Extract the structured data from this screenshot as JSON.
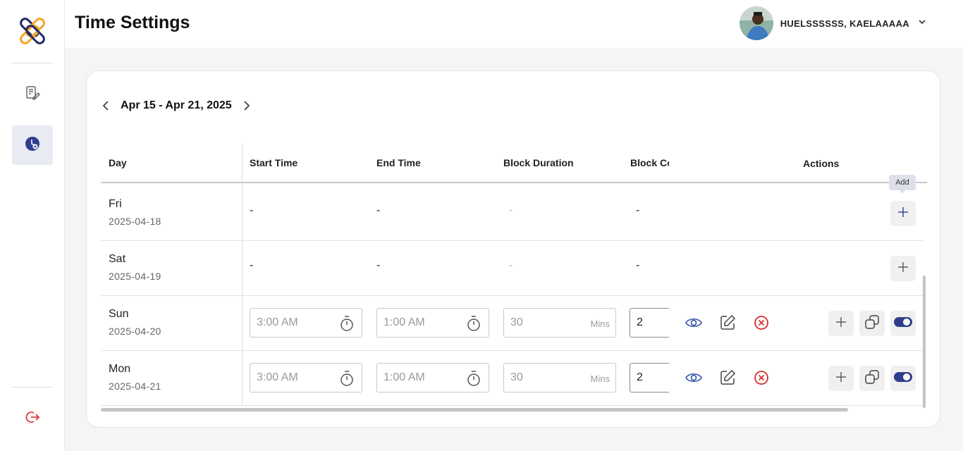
{
  "header": {
    "title": "Time Settings",
    "user_name": "HUELSSSSSS, KAELAAAAA"
  },
  "sidebar": {
    "items": [
      {
        "icon": "document-edit-icon"
      },
      {
        "icon": "schedule-settings-icon",
        "active": true
      },
      {
        "icon": "logout-icon"
      }
    ]
  },
  "date_nav": {
    "range": "Apr 15 - Apr 21, 2025"
  },
  "table": {
    "columns": {
      "day": "Day",
      "start": "Start Time",
      "end": "End Time",
      "duration": "Block Duration",
      "count": "Block Co",
      "actions": "Actions"
    },
    "tooltip": "Add",
    "rows": [
      {
        "day": "Fri",
        "date": "2025-04-18",
        "start": "-",
        "end": "-",
        "duration": "-",
        "count": "-"
      },
      {
        "day": "Sat",
        "date": "2025-04-19",
        "start": "-",
        "end": "-",
        "duration": "-",
        "count": "-"
      },
      {
        "day": "Sun",
        "date": "2025-04-20",
        "start": "3:00 AM",
        "end": "1:00 AM",
        "duration": "30",
        "unit": "Mins",
        "count": "2",
        "enabled": true
      },
      {
        "day": "Mon",
        "date": "2025-04-21",
        "start": "3:00 AM",
        "end": "1:00 AM",
        "duration": "30",
        "unit": "Mins",
        "count": "2",
        "enabled": true
      }
    ]
  },
  "colors": {
    "accent_blue": "#2f3e8c",
    "danger_red": "#d62d2d",
    "logo_orange": "#f5a623",
    "logo_navy": "#1f2b6b"
  }
}
